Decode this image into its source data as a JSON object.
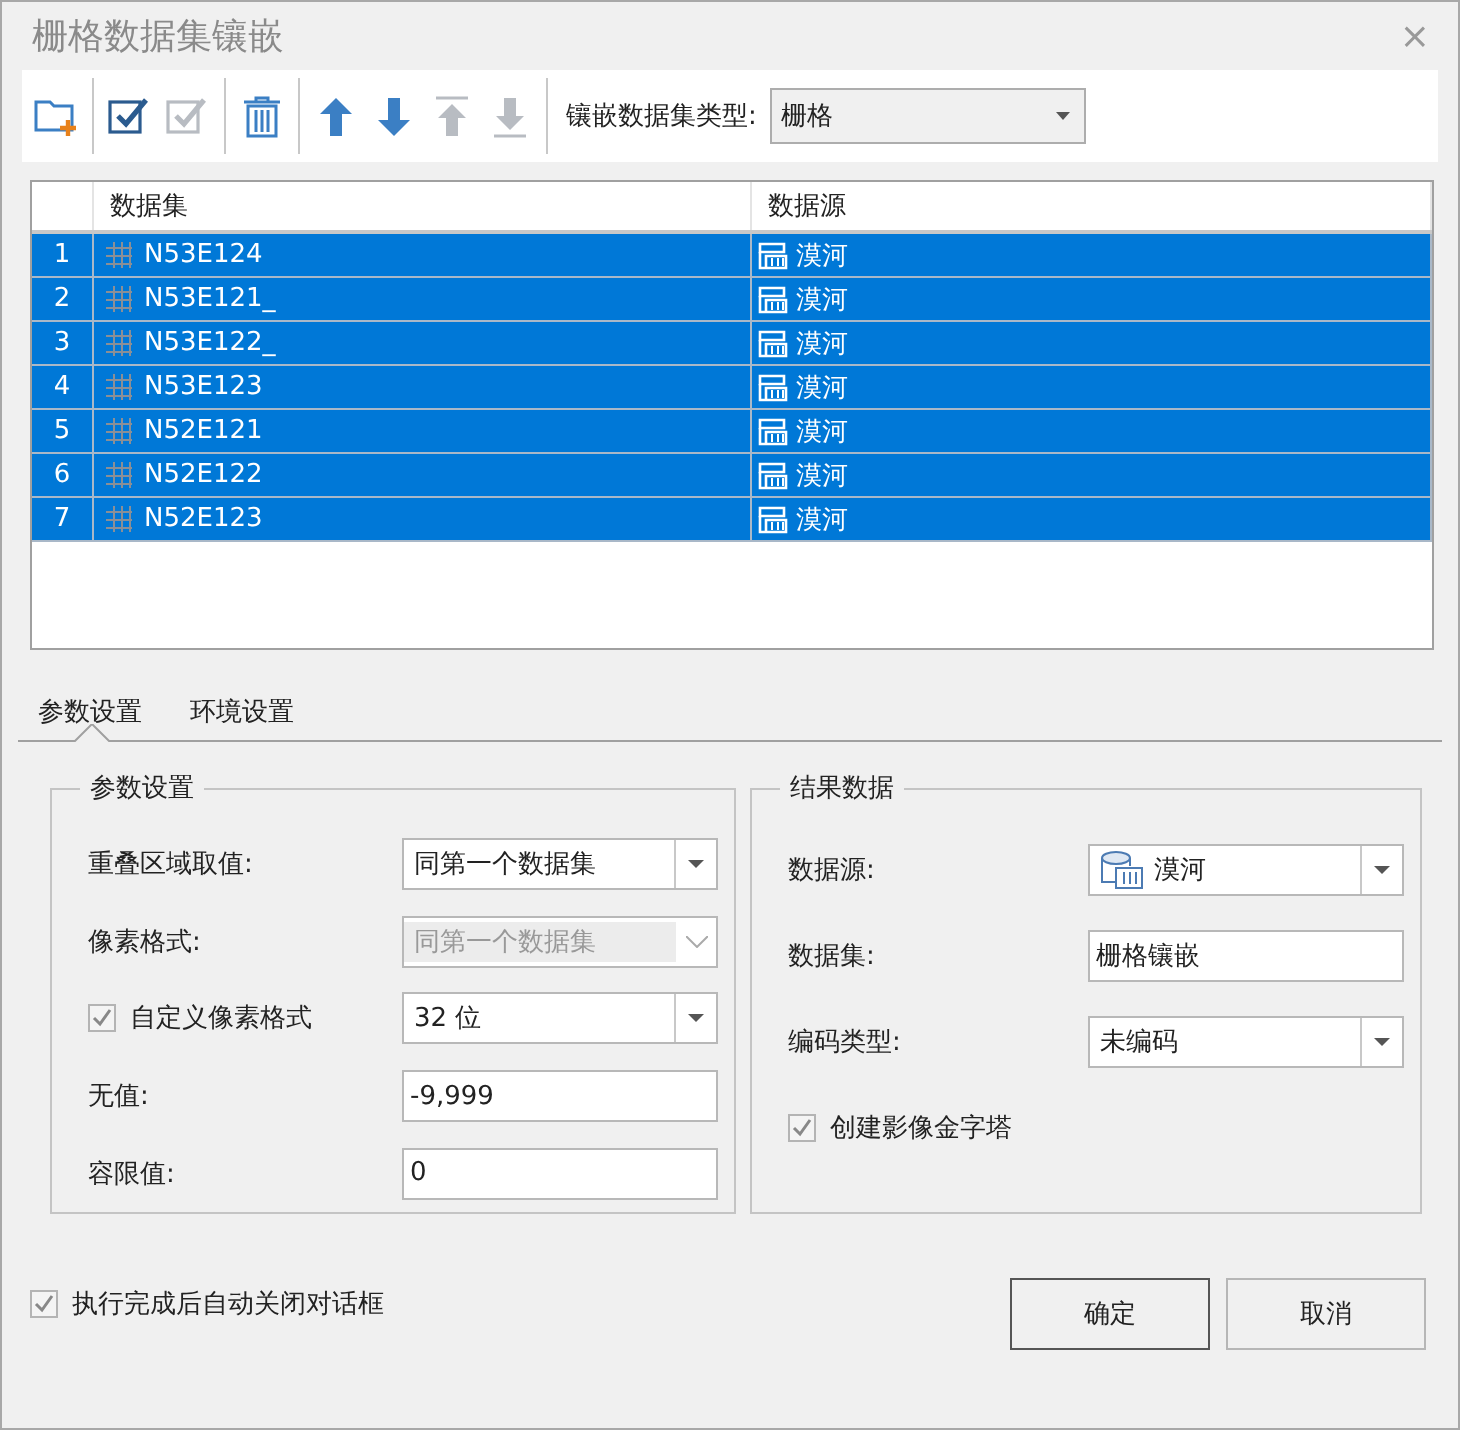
{
  "window": {
    "title": "栅格数据集镶嵌",
    "close": "×"
  },
  "toolbar": {
    "buttons": [
      {
        "kind": "add-folder",
        "disabled": false
      },
      {
        "kind": "check-all",
        "disabled": false
      },
      {
        "kind": "check-invert",
        "disabled": true
      },
      {
        "kind": "delete",
        "disabled": false
      },
      {
        "kind": "up",
        "disabled": false
      },
      {
        "kind": "down",
        "disabled": false
      },
      {
        "kind": "top",
        "disabled": true
      },
      {
        "kind": "bottom",
        "disabled": true
      }
    ],
    "mosaic_type": {
      "label": "镶嵌数据集类型:",
      "value": "栅格"
    }
  },
  "table": {
    "columns": [
      "数据集",
      "数据源"
    ],
    "rows": [
      {
        "index": "1",
        "dataset": "N53E124",
        "datasource": "漠河",
        "selected": true
      },
      {
        "index": "2",
        "dataset": "N53E121_",
        "datasource": "漠河",
        "selected": true
      },
      {
        "index": "3",
        "dataset": "N53E122_",
        "datasource": "漠河",
        "selected": true
      },
      {
        "index": "4",
        "dataset": "N53E123",
        "datasource": "漠河",
        "selected": true
      },
      {
        "index": "5",
        "dataset": "N52E121",
        "datasource": "漠河",
        "selected": true
      },
      {
        "index": "6",
        "dataset": "N52E122",
        "datasource": "漠河",
        "selected": true
      },
      {
        "index": "7",
        "dataset": "N52E123",
        "datasource": "漠河",
        "selected": true
      }
    ]
  },
  "tabs": [
    {
      "label": "参数设置",
      "selected": true
    },
    {
      "label": "环境设置",
      "selected": false
    }
  ],
  "groups": [
    {
      "title": "参数设置",
      "fields": [
        {
          "kind": "select",
          "label": "重叠区域取值:",
          "value": "同第一个数据集",
          "disabled": false
        },
        {
          "kind": "select",
          "label": "像素格式:",
          "value": "同第一个数据集",
          "disabled": true
        },
        {
          "kind": "checkbox-select",
          "label": "自定义像素格式",
          "checked": true,
          "value": "32 位"
        },
        {
          "kind": "input",
          "label": "无值:",
          "value": "-9,999"
        },
        {
          "kind": "input",
          "label": "容限值:",
          "value": "0"
        }
      ]
    },
    {
      "title": "结果数据",
      "fields": [
        {
          "kind": "datasource-select",
          "label": "数据源:",
          "value": "漠河"
        },
        {
          "kind": "input",
          "label": "数据集:",
          "value": "栅格镶嵌"
        },
        {
          "kind": "select",
          "label": "编码类型:",
          "value": "未编码",
          "disabled": false
        },
        {
          "kind": "checkbox",
          "label": "创建影像金字塔",
          "checked": true
        }
      ]
    }
  ],
  "footer": {
    "auto_close": {
      "label": "执行完成后自动关闭对话框",
      "checked": true
    },
    "buttons": [
      {
        "label": "确定",
        "default": true
      },
      {
        "label": "取消",
        "default": false
      }
    ]
  }
}
